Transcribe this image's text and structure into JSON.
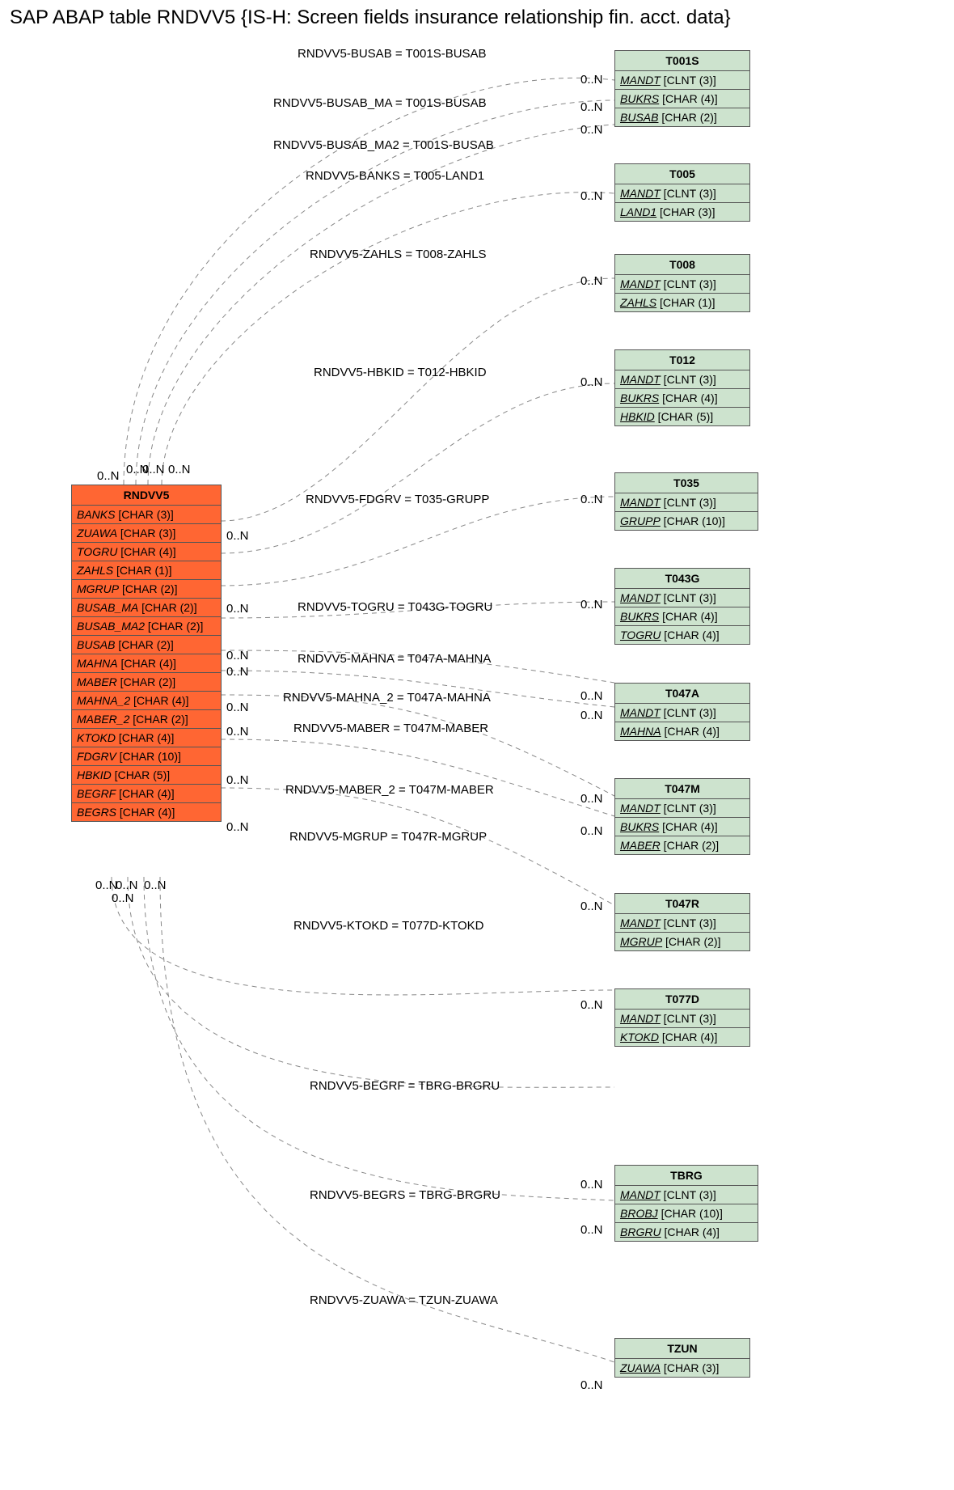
{
  "title": "SAP ABAP table RNDVV5 {IS-H: Screen fields insurance relationship fin. acct. data}",
  "main_entity": {
    "name": "RNDVV5",
    "fields": [
      {
        "name": "BANKS",
        "type": "CHAR (3)"
      },
      {
        "name": "ZUAWA",
        "type": "CHAR (3)"
      },
      {
        "name": "TOGRU",
        "type": "CHAR (4)"
      },
      {
        "name": "ZAHLS",
        "type": "CHAR (1)"
      },
      {
        "name": "MGRUP",
        "type": "CHAR (2)"
      },
      {
        "name": "BUSAB_MA",
        "type": "CHAR (2)"
      },
      {
        "name": "BUSAB_MA2",
        "type": "CHAR (2)"
      },
      {
        "name": "BUSAB",
        "type": "CHAR (2)"
      },
      {
        "name": "MAHNA",
        "type": "CHAR (4)"
      },
      {
        "name": "MABER",
        "type": "CHAR (2)"
      },
      {
        "name": "MAHNA_2",
        "type": "CHAR (4)"
      },
      {
        "name": "MABER_2",
        "type": "CHAR (2)"
      },
      {
        "name": "KTOKD",
        "type": "CHAR (4)"
      },
      {
        "name": "FDGRV",
        "type": "CHAR (10)"
      },
      {
        "name": "HBKID",
        "type": "CHAR (5)"
      },
      {
        "name": "BEGRF",
        "type": "CHAR (4)"
      },
      {
        "name": "BEGRS",
        "type": "CHAR (4)"
      }
    ]
  },
  "ref_entities": [
    {
      "name": "T001S",
      "fields": [
        {
          "n": "MANDT",
          "t": "CLNT (3)",
          "u": true
        },
        {
          "n": "BUKRS",
          "t": "CHAR (4)",
          "u": true
        },
        {
          "n": "BUSAB",
          "t": "CHAR (2)",
          "u": true
        }
      ]
    },
    {
      "name": "T005",
      "fields": [
        {
          "n": "MANDT",
          "t": "CLNT (3)",
          "u": true
        },
        {
          "n": "LAND1",
          "t": "CHAR (3)",
          "u": true
        }
      ]
    },
    {
      "name": "T008",
      "fields": [
        {
          "n": "MANDT",
          "t": "CLNT (3)",
          "u": true
        },
        {
          "n": "ZAHLS",
          "t": "CHAR (1)",
          "u": true
        }
      ]
    },
    {
      "name": "T012",
      "fields": [
        {
          "n": "MANDT",
          "t": "CLNT (3)",
          "u": true
        },
        {
          "n": "BUKRS",
          "t": "CHAR (4)",
          "u": true
        },
        {
          "n": "HBKID",
          "t": "CHAR (5)",
          "u": true
        }
      ]
    },
    {
      "name": "T035",
      "fields": [
        {
          "n": "MANDT",
          "t": "CLNT (3)",
          "u": true
        },
        {
          "n": "GRUPP",
          "t": "CHAR (10)",
          "u": true
        }
      ]
    },
    {
      "name": "T043G",
      "fields": [
        {
          "n": "MANDT",
          "t": "CLNT (3)",
          "u": true
        },
        {
          "n": "BUKRS",
          "t": "CHAR (4)",
          "u": true
        },
        {
          "n": "TOGRU",
          "t": "CHAR (4)",
          "u": true
        }
      ]
    },
    {
      "name": "T047A",
      "fields": [
        {
          "n": "MANDT",
          "t": "CLNT (3)",
          "u": true
        },
        {
          "n": "MAHNA",
          "t": "CHAR (4)",
          "u": true
        }
      ]
    },
    {
      "name": "T047M",
      "fields": [
        {
          "n": "MANDT",
          "t": "CLNT (3)",
          "u": true
        },
        {
          "n": "BUKRS",
          "t": "CHAR (4)",
          "u": true
        },
        {
          "n": "MABER",
          "t": "CHAR (2)",
          "u": true
        }
      ]
    },
    {
      "name": "T047R",
      "fields": [
        {
          "n": "MANDT",
          "t": "CLNT (3)",
          "u": true
        },
        {
          "n": "MGRUP",
          "t": "CHAR (2)",
          "u": true
        }
      ]
    },
    {
      "name": "T077D",
      "fields": [
        {
          "n": "MANDT",
          "t": "CLNT (3)",
          "u": true
        },
        {
          "n": "KTOKD",
          "t": "CHAR (4)",
          "u": true
        }
      ]
    },
    {
      "name": "TBRG",
      "fields": [
        {
          "n": "MANDT",
          "t": "CLNT (3)",
          "u": true
        },
        {
          "n": "BROBJ",
          "t": "CHAR (10)",
          "u": true
        },
        {
          "n": "BRGRU",
          "t": "CHAR (4)",
          "u": true
        }
      ]
    },
    {
      "name": "TZUN",
      "fields": [
        {
          "n": "ZUAWA",
          "t": "CHAR (3)",
          "u": true
        }
      ]
    }
  ],
  "edges": [
    {
      "label": "RNDVV5-BUSAB = T001S-BUSAB"
    },
    {
      "label": "RNDVV5-BUSAB_MA = T001S-BUSAB"
    },
    {
      "label": "RNDVV5-BUSAB_MA2 = T001S-BUSAB"
    },
    {
      "label": "RNDVV5-BANKS = T005-LAND1"
    },
    {
      "label": "RNDVV5-ZAHLS = T008-ZAHLS"
    },
    {
      "label": "RNDVV5-HBKID = T012-HBKID"
    },
    {
      "label": "RNDVV5-FDGRV = T035-GRUPP"
    },
    {
      "label": "RNDVV5-TOGRU = T043G-TOGRU"
    },
    {
      "label": "RNDVV5-MAHNA = T047A-MAHNA"
    },
    {
      "label": "RNDVV5-MAHNA_2 = T047A-MAHNA"
    },
    {
      "label": "RNDVV5-MABER = T047M-MABER"
    },
    {
      "label": "RNDVV5-MABER_2 = T047M-MABER"
    },
    {
      "label": "RNDVV5-MGRUP = T047R-MGRUP"
    },
    {
      "label": "RNDVV5-KTOKD = T077D-KTOKD"
    },
    {
      "label": "RNDVV5-BEGRF = TBRG-BRGRU"
    },
    {
      "label": "RNDVV5-BEGRS = TBRG-BRGRU"
    },
    {
      "label": "RNDVV5-ZUAWA = TZUN-ZUAWA"
    }
  ],
  "card": "0..N",
  "chart_data": {
    "type": "table",
    "description": "Entity-relationship diagram linking RNDVV5 fields to SAP check tables via foreign-key like relations with 0..N cardinality on both ends.",
    "relations": [
      {
        "from": "RNDVV5.BUSAB",
        "to": "T001S.BUSAB",
        "card_from": "0..N",
        "card_to": "0..N"
      },
      {
        "from": "RNDVV5.BUSAB_MA",
        "to": "T001S.BUSAB",
        "card_from": "0..N",
        "card_to": "0..N"
      },
      {
        "from": "RNDVV5.BUSAB_MA2",
        "to": "T001S.BUSAB",
        "card_from": "0..N",
        "card_to": "0..N"
      },
      {
        "from": "RNDVV5.BANKS",
        "to": "T005.LAND1",
        "card_from": "0..N",
        "card_to": "0..N"
      },
      {
        "from": "RNDVV5.ZAHLS",
        "to": "T008.ZAHLS",
        "card_from": "0..N",
        "card_to": "0..N"
      },
      {
        "from": "RNDVV5.HBKID",
        "to": "T012.HBKID",
        "card_from": "0..N",
        "card_to": "0..N"
      },
      {
        "from": "RNDVV5.FDGRV",
        "to": "T035.GRUPP",
        "card_from": "0..N",
        "card_to": "0..N"
      },
      {
        "from": "RNDVV5.TOGRU",
        "to": "T043G.TOGRU",
        "card_from": "0..N",
        "card_to": "0..N"
      },
      {
        "from": "RNDVV5.MAHNA",
        "to": "T047A.MAHNA",
        "card_from": "0..N",
        "card_to": "0..N"
      },
      {
        "from": "RNDVV5.MAHNA_2",
        "to": "T047A.MAHNA",
        "card_from": "0..N",
        "card_to": "0..N"
      },
      {
        "from": "RNDVV5.MABER",
        "to": "T047M.MABER",
        "card_from": "0..N",
        "card_to": "0..N"
      },
      {
        "from": "RNDVV5.MABER_2",
        "to": "T047M.MABER",
        "card_from": "0..N",
        "card_to": "0..N"
      },
      {
        "from": "RNDVV5.MGRUP",
        "to": "T047R.MGRUP",
        "card_from": "0..N",
        "card_to": "0..N"
      },
      {
        "from": "RNDVV5.KTOKD",
        "to": "T077D.KTOKD",
        "card_from": "0..N",
        "card_to": "0..N"
      },
      {
        "from": "RNDVV5.BEGRF",
        "to": "TBRG.BRGRU",
        "card_from": "0..N",
        "card_to": "0..N"
      },
      {
        "from": "RNDVV5.BEGRS",
        "to": "TBRG.BRGRU",
        "card_from": "0..N",
        "card_to": "0..N"
      },
      {
        "from": "RNDVV5.ZUAWA",
        "to": "TZUN.ZUAWA",
        "card_from": "0..N",
        "card_to": "0..N"
      }
    ]
  }
}
